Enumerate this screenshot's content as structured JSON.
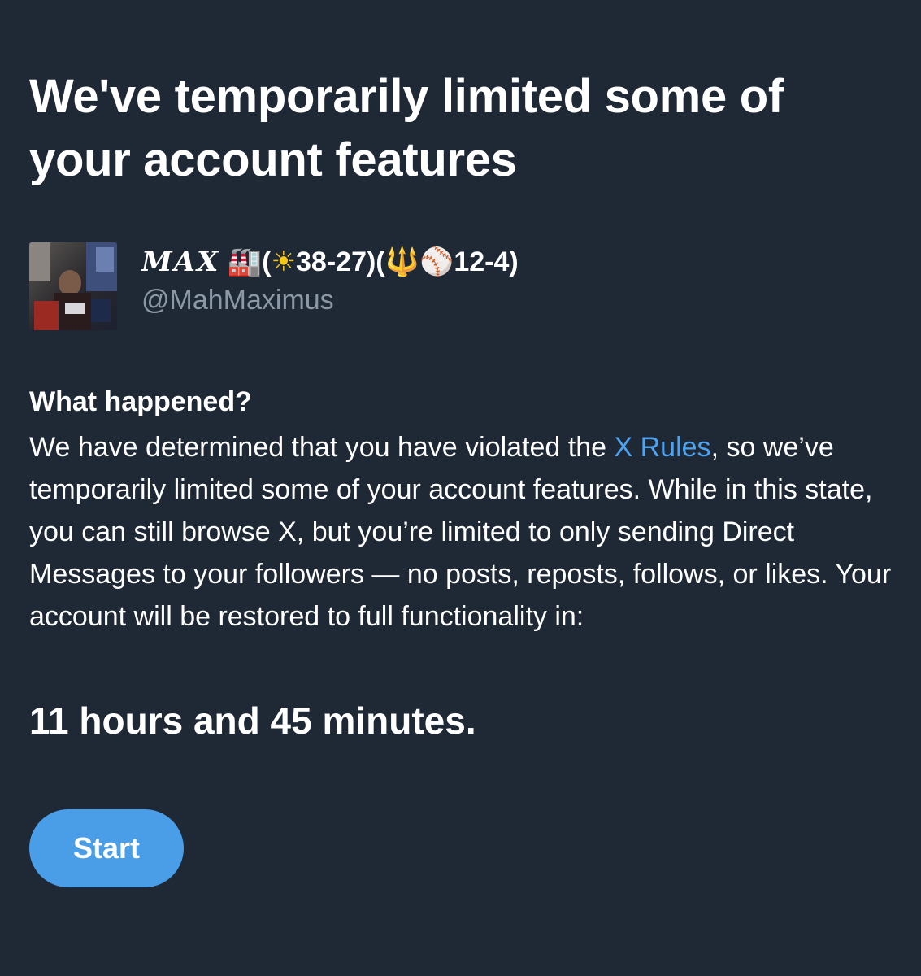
{
  "header": {
    "title_line1": "We've temporarily limited some of",
    "title_line2": "your account features"
  },
  "account": {
    "display_name_script": "MAX",
    "display_name_emoji1": "🏭",
    "display_name_paren1_open": "(",
    "display_name_emoji2": "☀",
    "display_name_record1": "38-27)(",
    "display_name_emoji3": "🔱",
    "display_name_emoji4": "⚾",
    "display_name_record2": "12-4)",
    "handle": "@MahMaximus"
  },
  "section": {
    "heading": "What happened?",
    "body_part1": "We have determined that you have violated the ",
    "link_text": "X Rules",
    "body_part2": ", so we’ve temporarily limited some of your account features. While in this state, you can still browse X, but you’re limited to only sending Direct Messages to your followers — no posts, reposts, follows, or likes. Your account will be restored to full functionality in:"
  },
  "countdown": "11 hours and 45 minutes.",
  "actions": {
    "start_label": "Start"
  },
  "colors": {
    "background": "#1f2835",
    "link": "#4da3f0",
    "button": "#4a9ee8",
    "muted_text": "#8b98a5"
  }
}
